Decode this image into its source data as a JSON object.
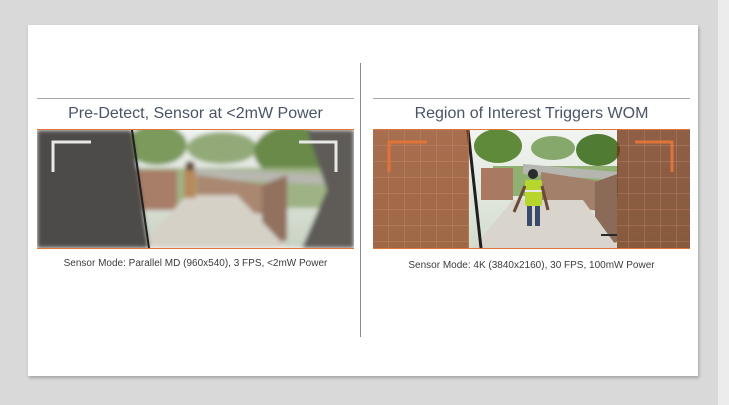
{
  "panels": [
    {
      "title": "Pre-Detect, Sensor at <2mW Power",
      "caption": "Sensor Mode: Parallel MD (960x540), 3 FPS, <2mW Power"
    },
    {
      "title": "Region of Interest Triggers WOM",
      "caption": "Sensor Mode: 4K (3840x2160), 30 FPS, 100mW Power"
    }
  ],
  "colors": {
    "accent": "#e0733a",
    "title_text": "#4a5466",
    "roi_tint": "#8a3a10"
  }
}
